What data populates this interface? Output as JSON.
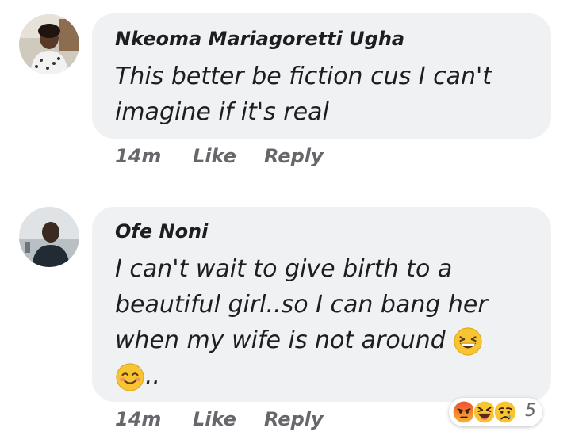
{
  "comments": [
    {
      "author": "Nkeoma Mariagoretti Ugha",
      "text_lines": [
        "This better be fiction cus I can't",
        "imagine if it's real"
      ],
      "time": "14m",
      "like_label": "Like",
      "reply_label": "Reply",
      "avatar": "profile-photo-woman"
    },
    {
      "author": "Ofe Noni",
      "text_lines": [
        "I can't wait to give birth to a",
        "beautiful girl..so I can bang her",
        "when my wife is not around",
        ".."
      ],
      "inline_emojis": [
        "grinning-squinting-face",
        "smiling-face-with-smiling-eyes"
      ],
      "time": "14m",
      "like_label": "Like",
      "reply_label": "Reply",
      "avatar": "profile-photo-man",
      "reactions": {
        "icons": [
          "angry-reaction-icon",
          "haha-reaction-icon",
          "sad-reaction-icon"
        ],
        "count": "5"
      }
    }
  ],
  "colors": {
    "bubble": "#eff1f3",
    "meta_text": "#65676b",
    "text": "#1c1e21"
  }
}
